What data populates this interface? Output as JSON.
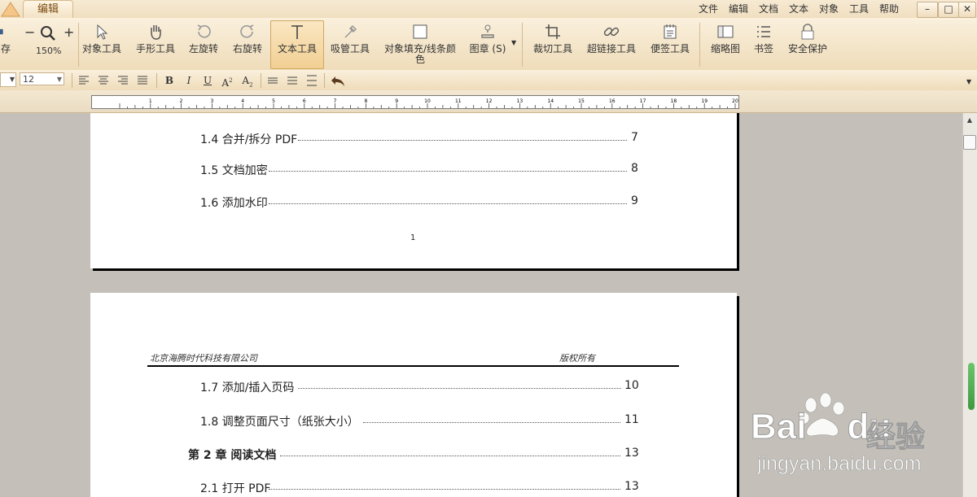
{
  "tabs": {
    "active": "编辑"
  },
  "menu": [
    "文件",
    "编辑",
    "文档",
    "文本",
    "对象",
    "工具",
    "帮助"
  ],
  "window": {
    "minimize": "–",
    "maximize": "□",
    "close": "✕"
  },
  "ribbon": {
    "save": "存",
    "zoom": "150%",
    "tools": [
      "对象工具",
      "手形工具",
      "左旋转",
      "右旋转",
      "文本工具",
      "吸管工具",
      "对象填充/线条颜色",
      "图章 (S)",
      "裁切工具",
      "超链接工具",
      "便签工具",
      "缩略图",
      "书签",
      "安全保护"
    ]
  },
  "format": {
    "font_size": "12"
  },
  "page1": {
    "toc": [
      {
        "label": "1.4 合并/拆分 PDF",
        "page": "7"
      },
      {
        "label": "1.5 文档加密",
        "page": "8"
      },
      {
        "label": "1.6 添加水印",
        "page": "9"
      }
    ],
    "page_number": "1"
  },
  "page2": {
    "header_left": "北京海腾时代科技有限公司",
    "header_right": "版权所有",
    "toc": [
      {
        "label": "1.7 添加/插入页码",
        "page": "10"
      },
      {
        "label": "1.8 调整页面尺寸（纸张大小）",
        "page": "11"
      },
      {
        "label": "第 2 章  阅读文档",
        "page": "13"
      },
      {
        "label": "2.1 打开 PDF",
        "page": "13"
      }
    ]
  },
  "watermark": {
    "brand": "Bai",
    "brand2": "du",
    "cn": "经验",
    "url": "jingyan.baidu.com"
  }
}
